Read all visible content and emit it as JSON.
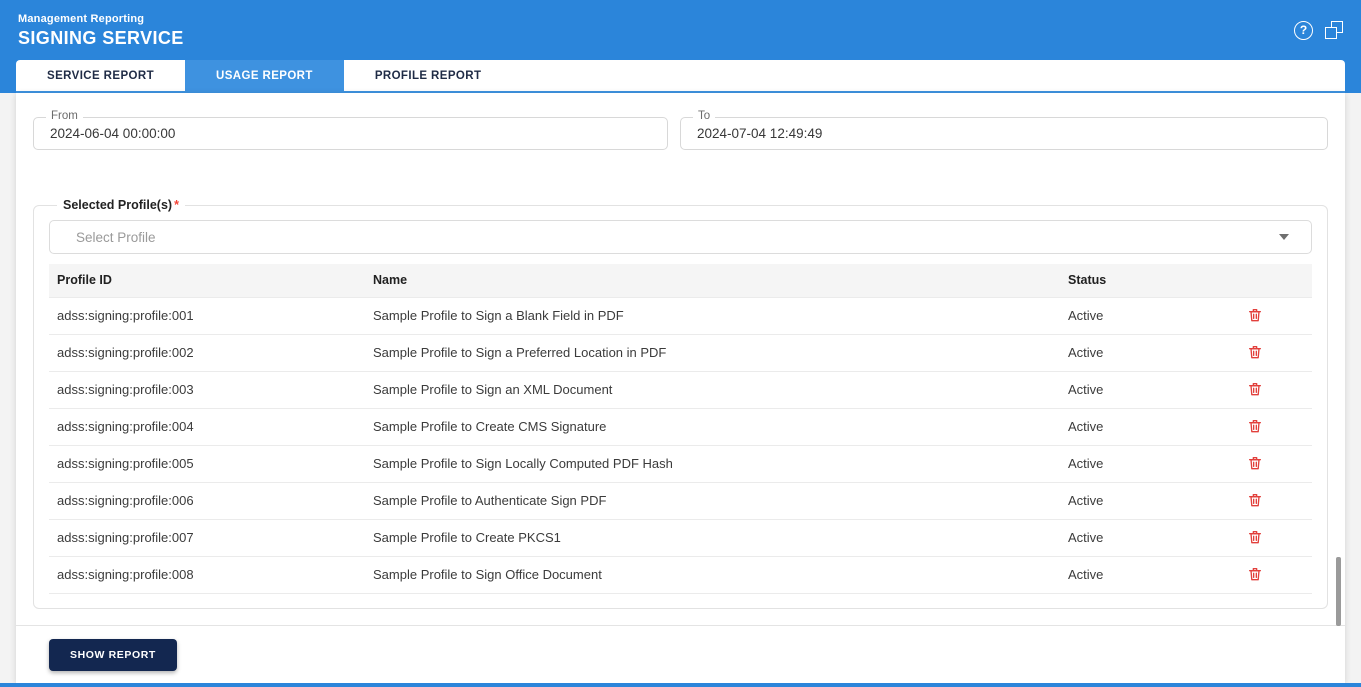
{
  "header": {
    "app_label": "Management Reporting",
    "title": "SIGNING SERVICE",
    "help_glyph": "?"
  },
  "tabs": {
    "items": [
      {
        "label": "SERVICE REPORT",
        "active": false
      },
      {
        "label": "USAGE REPORT",
        "active": true
      },
      {
        "label": "PROFILE REPORT",
        "active": false
      }
    ]
  },
  "filters": {
    "from": {
      "label": "From",
      "value": "2024-06-04 00:00:00"
    },
    "to": {
      "label": "To",
      "value": "2024-07-04 12:49:49"
    }
  },
  "profiles": {
    "section_label": "Selected Profile(s)",
    "required_marker": "*",
    "select_placeholder": "Select Profile",
    "table": {
      "columns": [
        "Profile ID",
        "Name",
        "Status"
      ],
      "rows": [
        {
          "profile_id": "adss:signing:profile:001",
          "name": "Sample Profile to Sign a Blank Field in PDF",
          "status": "Active"
        },
        {
          "profile_id": "adss:signing:profile:002",
          "name": "Sample Profile to Sign a Preferred Location in PDF",
          "status": "Active"
        },
        {
          "profile_id": "adss:signing:profile:003",
          "name": "Sample Profile to Sign an XML Document",
          "status": "Active"
        },
        {
          "profile_id": "adss:signing:profile:004",
          "name": "Sample Profile to Create CMS Signature",
          "status": "Active"
        },
        {
          "profile_id": "adss:signing:profile:005",
          "name": "Sample Profile to Sign Locally Computed PDF Hash",
          "status": "Active"
        },
        {
          "profile_id": "adss:signing:profile:006",
          "name": "Sample Profile to Authenticate Sign PDF",
          "status": "Active"
        },
        {
          "profile_id": "adss:signing:profile:007",
          "name": "Sample Profile to Create PKCS1",
          "status": "Active"
        },
        {
          "profile_id": "adss:signing:profile:008",
          "name": "Sample Profile to Sign Office Document",
          "status": "Active"
        }
      ]
    }
  },
  "actions": {
    "show_report_label": "SHOW REPORT"
  },
  "colors": {
    "header_blue": "#2b85da",
    "active_tab_blue": "#3e92e0",
    "button_navy": "#132750",
    "delete_red": "#e2403c",
    "required_red": "#f44336",
    "table_header_bg": "#f5f5f5"
  }
}
